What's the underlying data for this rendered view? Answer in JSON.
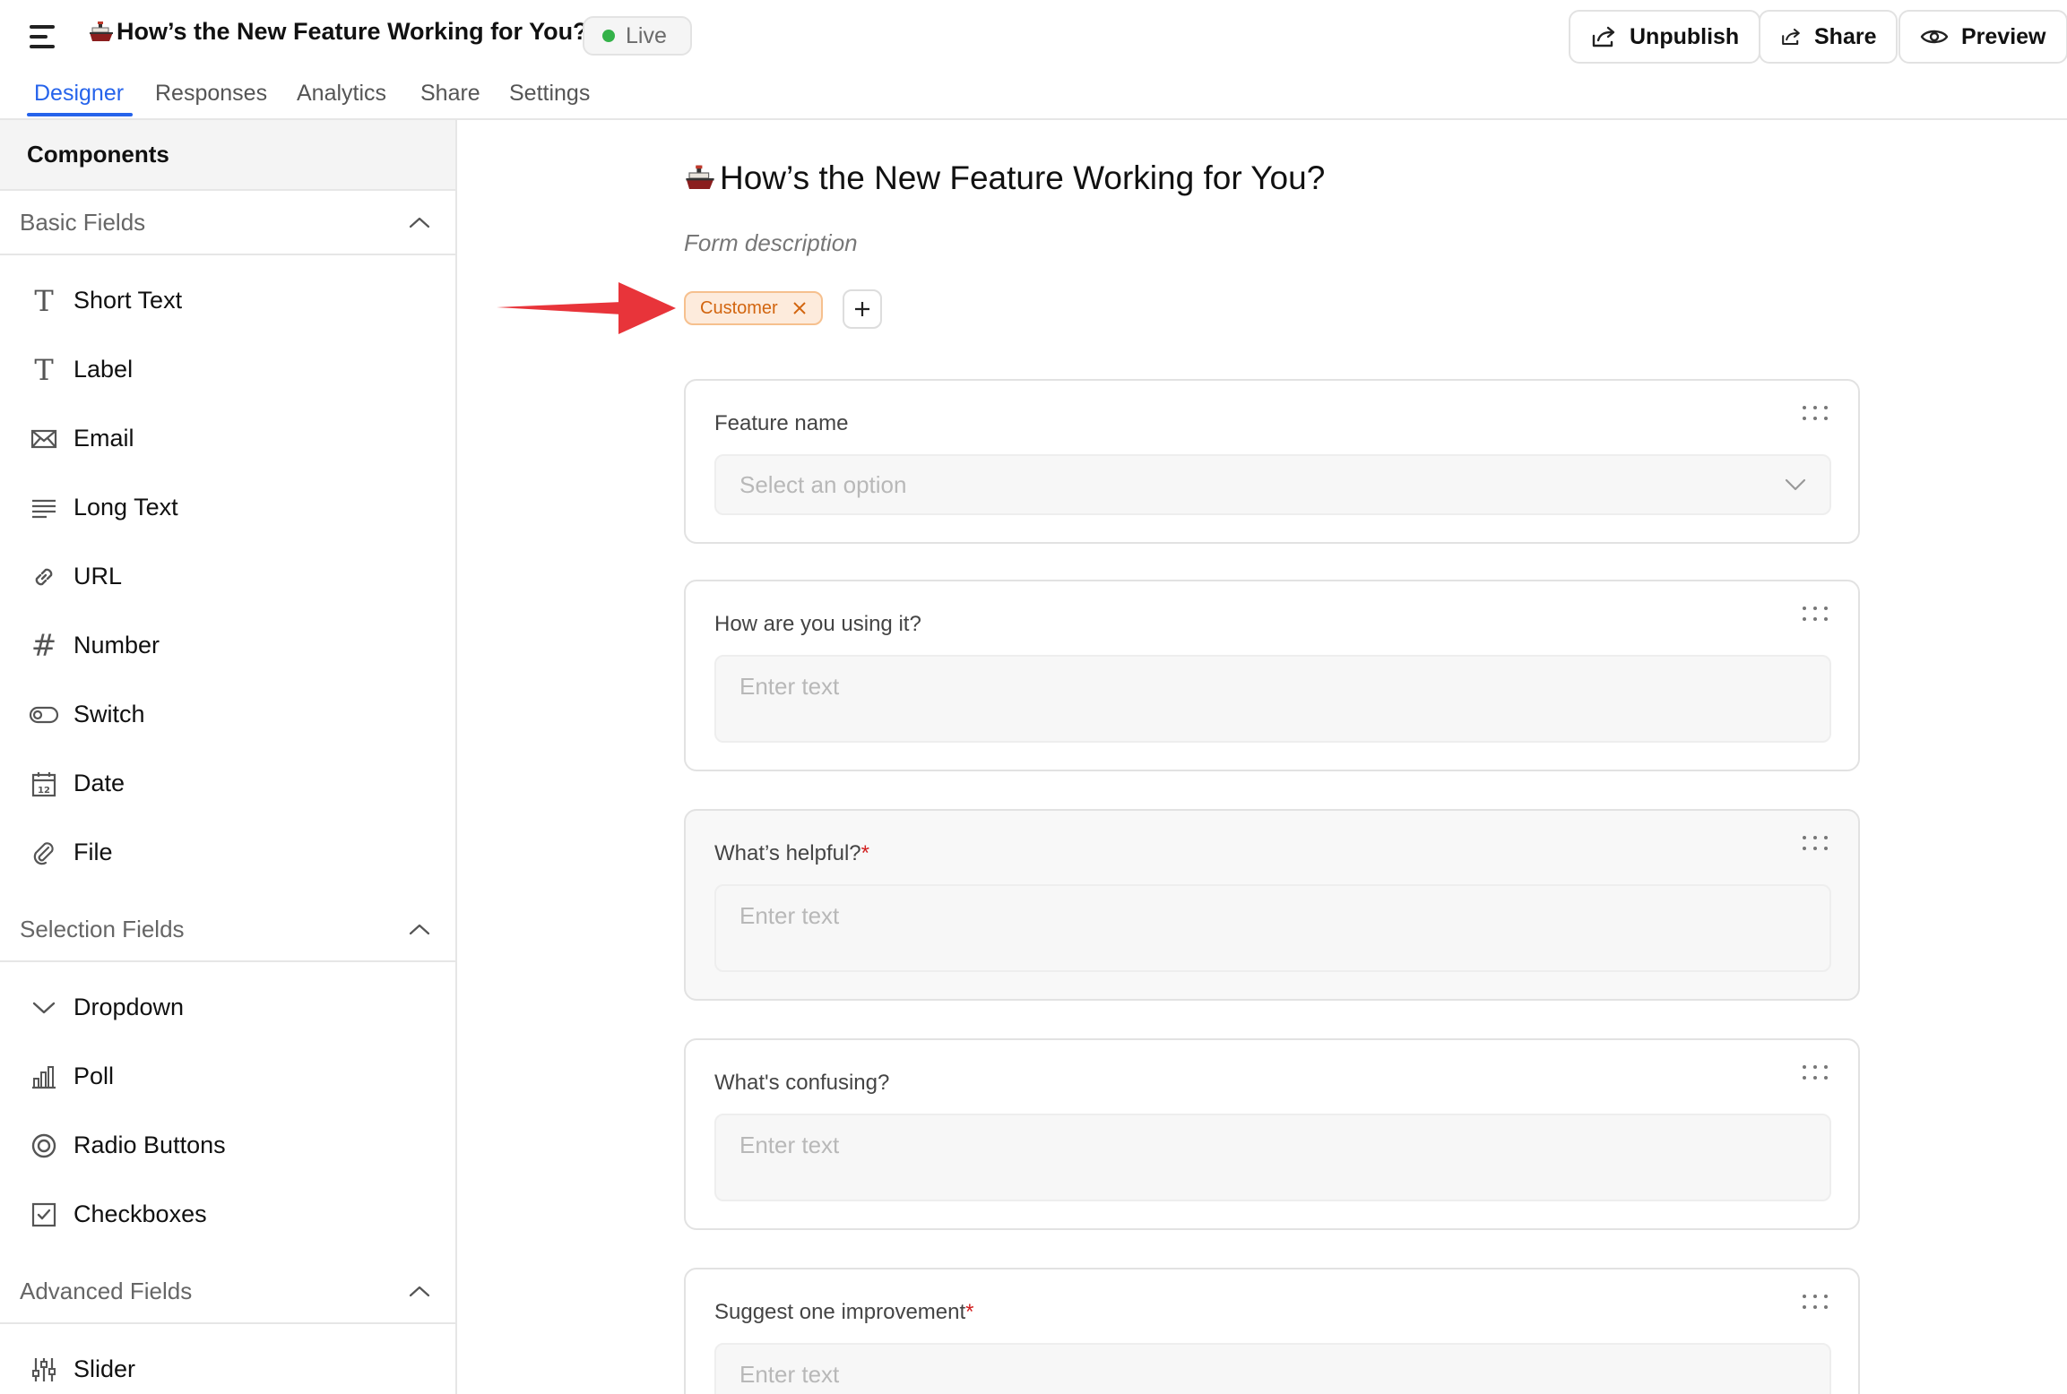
{
  "header": {
    "title": "How’s the New Feature Working for You?",
    "status": "Live",
    "buttons": {
      "unpublish": "Unpublish",
      "share": "Share",
      "preview": "Preview"
    }
  },
  "tabs": [
    "Designer",
    "Responses",
    "Analytics",
    "Share",
    "Settings"
  ],
  "active_tab": "Designer",
  "sidebar": {
    "title": "Components",
    "sections": [
      {
        "title": "Basic Fields",
        "items": [
          "Short Text",
          "Label",
          "Email",
          "Long Text",
          "URL",
          "Number",
          "Switch",
          "Date",
          "File"
        ]
      },
      {
        "title": "Selection Fields",
        "items": [
          "Dropdown",
          "Poll",
          "Radio Buttons",
          "Checkboxes"
        ]
      },
      {
        "title": "Advanced Fields",
        "items": [
          "Slider"
        ]
      }
    ]
  },
  "form": {
    "title": "How’s the New Feature Working for You?",
    "description": "Form description",
    "tags": [
      "Customer"
    ],
    "fields": [
      {
        "label": "Feature name",
        "required": false,
        "type": "select",
        "placeholder": "Select an option"
      },
      {
        "label": "How are you using it?",
        "required": false,
        "type": "text",
        "placeholder": "Enter text"
      },
      {
        "label": "What’s helpful?",
        "required": true,
        "type": "text",
        "placeholder": "Enter text"
      },
      {
        "label": "What's confusing?",
        "required": false,
        "type": "text",
        "placeholder": "Enter text"
      },
      {
        "label": "Suggest one improvement",
        "required": true,
        "type": "text",
        "placeholder": "Enter text"
      }
    ]
  },
  "colors": {
    "accent": "#2563eb",
    "live_dot": "#34b249",
    "tag_text": "#d2650f",
    "tag_bg": "#fdebdc",
    "required_star": "#d12020",
    "annotation_arrow": "#e8343a"
  },
  "icons": {
    "menu": "hamburger-menu-icon",
    "title_emoji": "ship-icon",
    "unpublish": "share-out-icon",
    "share": "share-out-icon",
    "preview": "eye-icon"
  }
}
